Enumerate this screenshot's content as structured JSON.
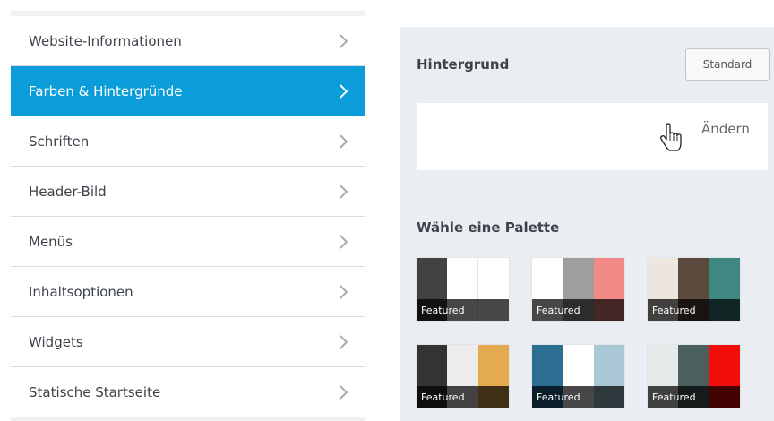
{
  "menu": {
    "items": [
      {
        "label": "Website-Informationen",
        "active": false
      },
      {
        "label": "Farben & Hintergründe",
        "active": true
      },
      {
        "label": "Schriften",
        "active": false
      },
      {
        "label": "Header-Bild",
        "active": false
      },
      {
        "label": "Menüs",
        "active": false
      },
      {
        "label": "Inhaltsoptionen",
        "active": false
      },
      {
        "label": "Widgets",
        "active": false
      },
      {
        "label": "Statische Startseite",
        "active": false
      }
    ],
    "accent_color": "#0a9dd9",
    "chevron_icon": "chevron-right-icon"
  },
  "background": {
    "title": "Hintergrund",
    "default_button": "Standard",
    "change_link": "Ändern",
    "cursor_icon": "hand-pointer-icon"
  },
  "palettes": {
    "title": "Wähle eine Palette",
    "items": [
      {
        "tag": "Featured",
        "colors": [
          "#424242",
          "#ffffff",
          "#ffffff"
        ]
      },
      {
        "tag": "Featured",
        "colors": [
          "#ffffff",
          "#9e9e9e",
          "#f28b87"
        ]
      },
      {
        "tag": "Featured",
        "colors": [
          "#ede6df",
          "#5b4a3d",
          "#3f8882"
        ]
      },
      {
        "tag": "Featured",
        "colors": [
          "#333333",
          "#ececec",
          "#e3aa4f"
        ]
      },
      {
        "tag": "Featured",
        "colors": [
          "#2b6e92",
          "#ffffff",
          "#aac8d6"
        ]
      },
      {
        "tag": "Featured",
        "colors": [
          "#e6ebea",
          "#4b5f5d",
          "#f20d0d"
        ]
      }
    ]
  }
}
